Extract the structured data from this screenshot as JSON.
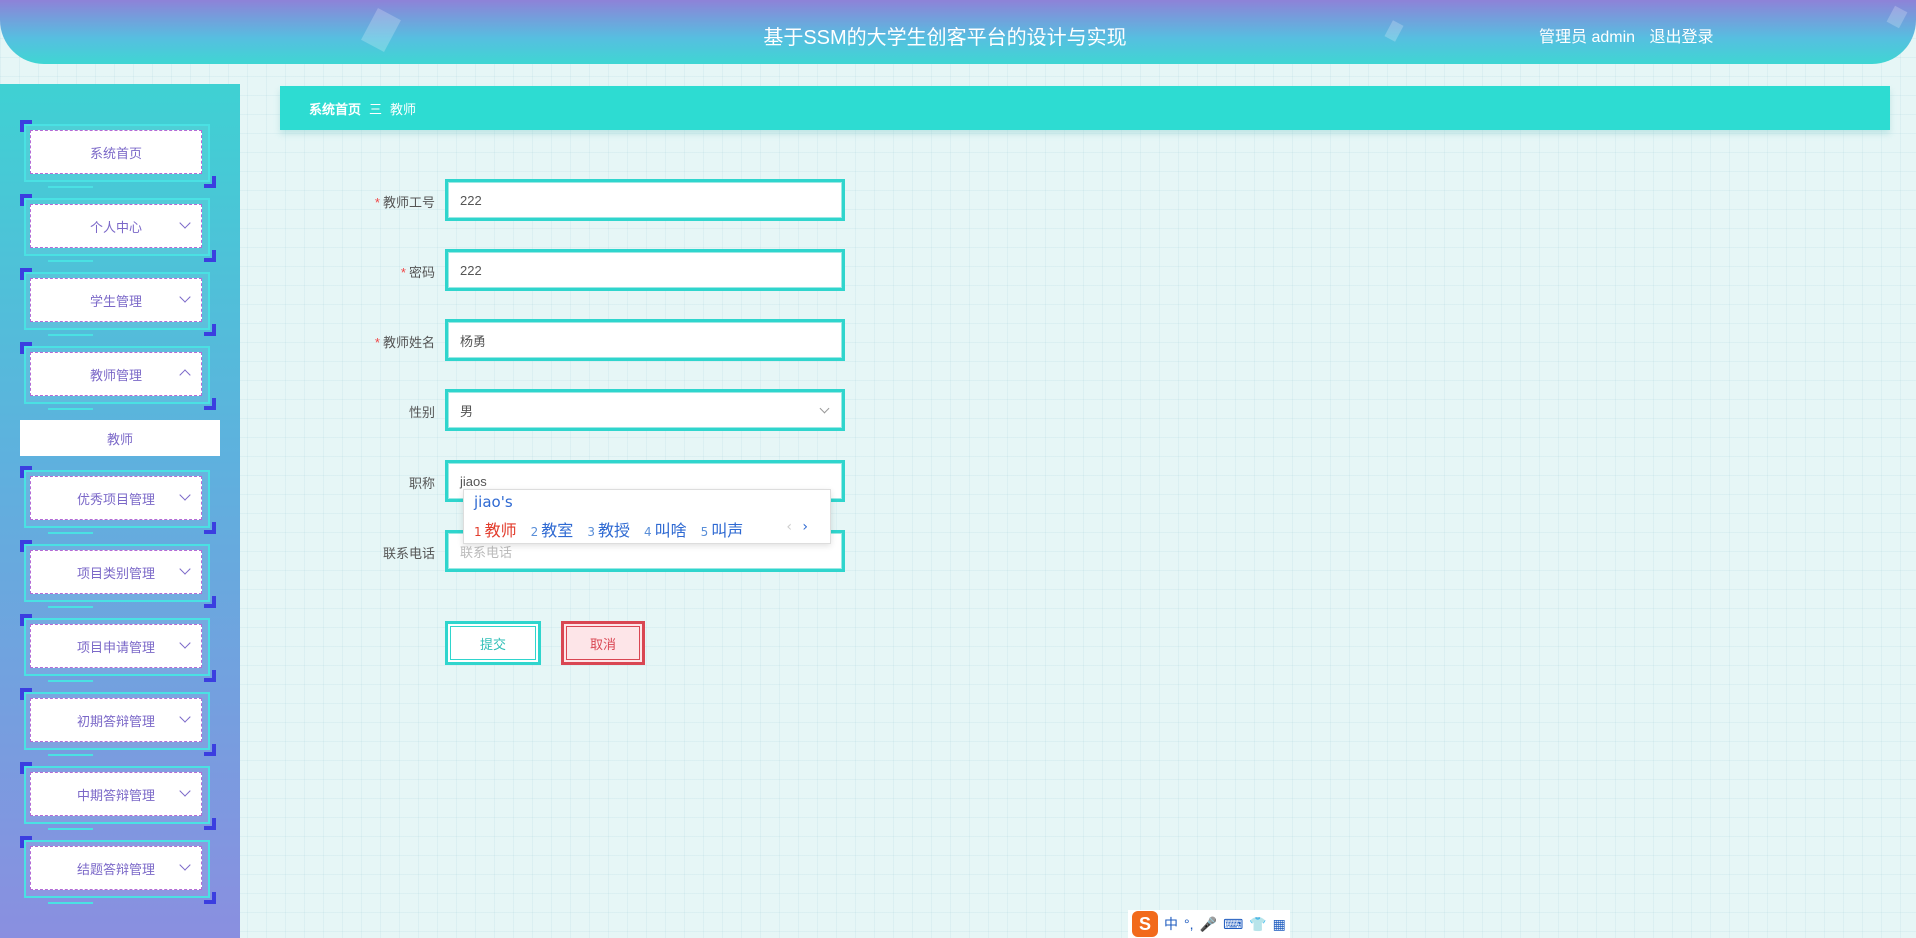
{
  "header": {
    "title": "基于SSM的大学生创客平台的设计与实现",
    "user_label": "管理员 admin",
    "logout_label": "退出登录"
  },
  "sidebar": {
    "items": [
      {
        "label": "系统首页",
        "has_chevron": false
      },
      {
        "label": "个人中心",
        "has_chevron": true
      },
      {
        "label": "学生管理",
        "has_chevron": true
      },
      {
        "label": "教师管理",
        "has_chevron": true,
        "expanded": true
      },
      {
        "label": "优秀项目管理",
        "has_chevron": true
      },
      {
        "label": "项目类别管理",
        "has_chevron": true
      },
      {
        "label": "项目申请管理",
        "has_chevron": true
      },
      {
        "label": "初期答辩管理",
        "has_chevron": true
      },
      {
        "label": "中期答辩管理",
        "has_chevron": true
      },
      {
        "label": "结题答辩管理",
        "has_chevron": true
      }
    ],
    "sub_item": "教师"
  },
  "breadcrumb": {
    "home": "系统首页",
    "separator": "三",
    "current": "教师"
  },
  "form": {
    "fields": [
      {
        "label": "教师工号",
        "required": true,
        "value": "222"
      },
      {
        "label": "密码",
        "required": true,
        "value": "222"
      },
      {
        "label": "教师姓名",
        "required": true,
        "value": "杨勇"
      },
      {
        "label": "性别",
        "required": false,
        "value": "男"
      },
      {
        "label": "职称",
        "required": false,
        "value": "jiaos"
      },
      {
        "label": "联系电话",
        "required": false,
        "value": "",
        "placeholder": "联系电话"
      }
    ],
    "required_mark": "*",
    "submit_label": "提交",
    "cancel_label": "取消"
  },
  "ime": {
    "composition": "jiao's",
    "candidates": [
      {
        "num": "1",
        "text": "教师"
      },
      {
        "num": "2",
        "text": "教室"
      },
      {
        "num": "3",
        "text": "教授"
      },
      {
        "num": "4",
        "text": "叫啥"
      },
      {
        "num": "5",
        "text": "叫声"
      }
    ],
    "prev": "‹",
    "next": "›",
    "toolbar": {
      "logo": "S",
      "mode": "中",
      "punct": "°,"
    }
  },
  "colors": {
    "accent": "#2ddcd2",
    "sidebar_text": "#7b68c8",
    "danger": "#d94652",
    "ime_blue": "#2e69d2",
    "ime_red": "#e23c2c"
  }
}
